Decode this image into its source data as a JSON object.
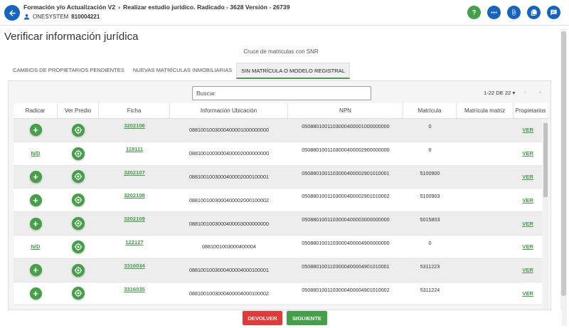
{
  "header": {
    "crumb1": "Formación y/o Actualización V2",
    "crumb2": "Realizar estudio jurídico. Radicado - 3628 Versión - 26739",
    "user_name": "ONESYSTEM",
    "user_id": "810004221",
    "icons": [
      "help-icon",
      "more-icon",
      "attachment-icon",
      "copy-icon",
      "message-icon"
    ]
  },
  "page": {
    "title": "Verificar información jurídica",
    "subtitle": "Cruce de matriculas con SNR"
  },
  "tabs": [
    {
      "label": "CAMBIOS DE PROPIETARIOS PENDIENTES"
    },
    {
      "label": "NUEVAS MATRÍCULAS INMOBILIARIAS"
    },
    {
      "label": "SIN MATRÍCULA O MODELO REGISTRAL"
    }
  ],
  "search": {
    "placeholder": "Buscar"
  },
  "pager": {
    "range": "1-22 DE 22",
    "caret": "▾",
    "prev": "‹",
    "next": "›"
  },
  "columns": [
    "Radicar",
    "Ver Predio",
    "Ficha",
    "Información Ubicación",
    "NPN",
    "Matrícula",
    "Matrícula matriz",
    "Propietarios"
  ],
  "rows": [
    {
      "radicar": "+",
      "ficha": "3202106",
      "ubicacion": "0881001003000400001000000000",
      "npn": "0508801001103000400001000000000",
      "matricula": "0",
      "matriz": "",
      "propietarios": "VER"
    },
    {
      "radicar": "N/D",
      "ficha": "118111",
      "ubicacion": "0881001003000400002000000000",
      "npn": "0508801001103000400002900000000",
      "matricula": "0",
      "matriz": "",
      "propietarios": "VER"
    },
    {
      "radicar": "+",
      "ficha": "3202107",
      "ubicacion": "0881001003000400002000100001",
      "npn": "0508801001103000400002901010001",
      "matricula": "5100900",
      "matriz": "",
      "propietarios": "VER"
    },
    {
      "radicar": "+",
      "ficha": "3202108",
      "ubicacion": "0881001003000400002000100002",
      "npn": "0508801001103000400002901010002",
      "matricula": "5100903",
      "matriz": "",
      "propietarios": "VER"
    },
    {
      "radicar": "+",
      "ficha": "3202109",
      "ubicacion": "0881001003000400003000000000",
      "npn": "0508801001103000400003000000000",
      "matricula": "5015803",
      "matriz": "",
      "propietarios": "VER"
    },
    {
      "radicar": "N/D",
      "ficha": "122127",
      "ubicacion": "0881001003000400004",
      "npn": "0508801001103000400004900000000",
      "matricula": "0",
      "matriz": "",
      "propietarios": "VER"
    },
    {
      "radicar": "+",
      "ficha": "3316034",
      "ubicacion": "0881001003000400004000100001",
      "npn": "0508801001103000400004901010001",
      "matricula": "5311223",
      "matriz": "",
      "propietarios": "VER"
    },
    {
      "radicar": "+",
      "ficha": "3316035",
      "ubicacion": "0881001003000400004000100002",
      "npn": "0508801001103000400004901010002",
      "matricula": "5311224",
      "matriz": "",
      "propietarios": "VER"
    }
  ],
  "buttons": {
    "devolver": "DEVOLVER",
    "siguiente": "SIGUIENTE"
  },
  "colors": {
    "primary": "#1565c0",
    "accent": "#43a047",
    "danger": "#e53935"
  }
}
